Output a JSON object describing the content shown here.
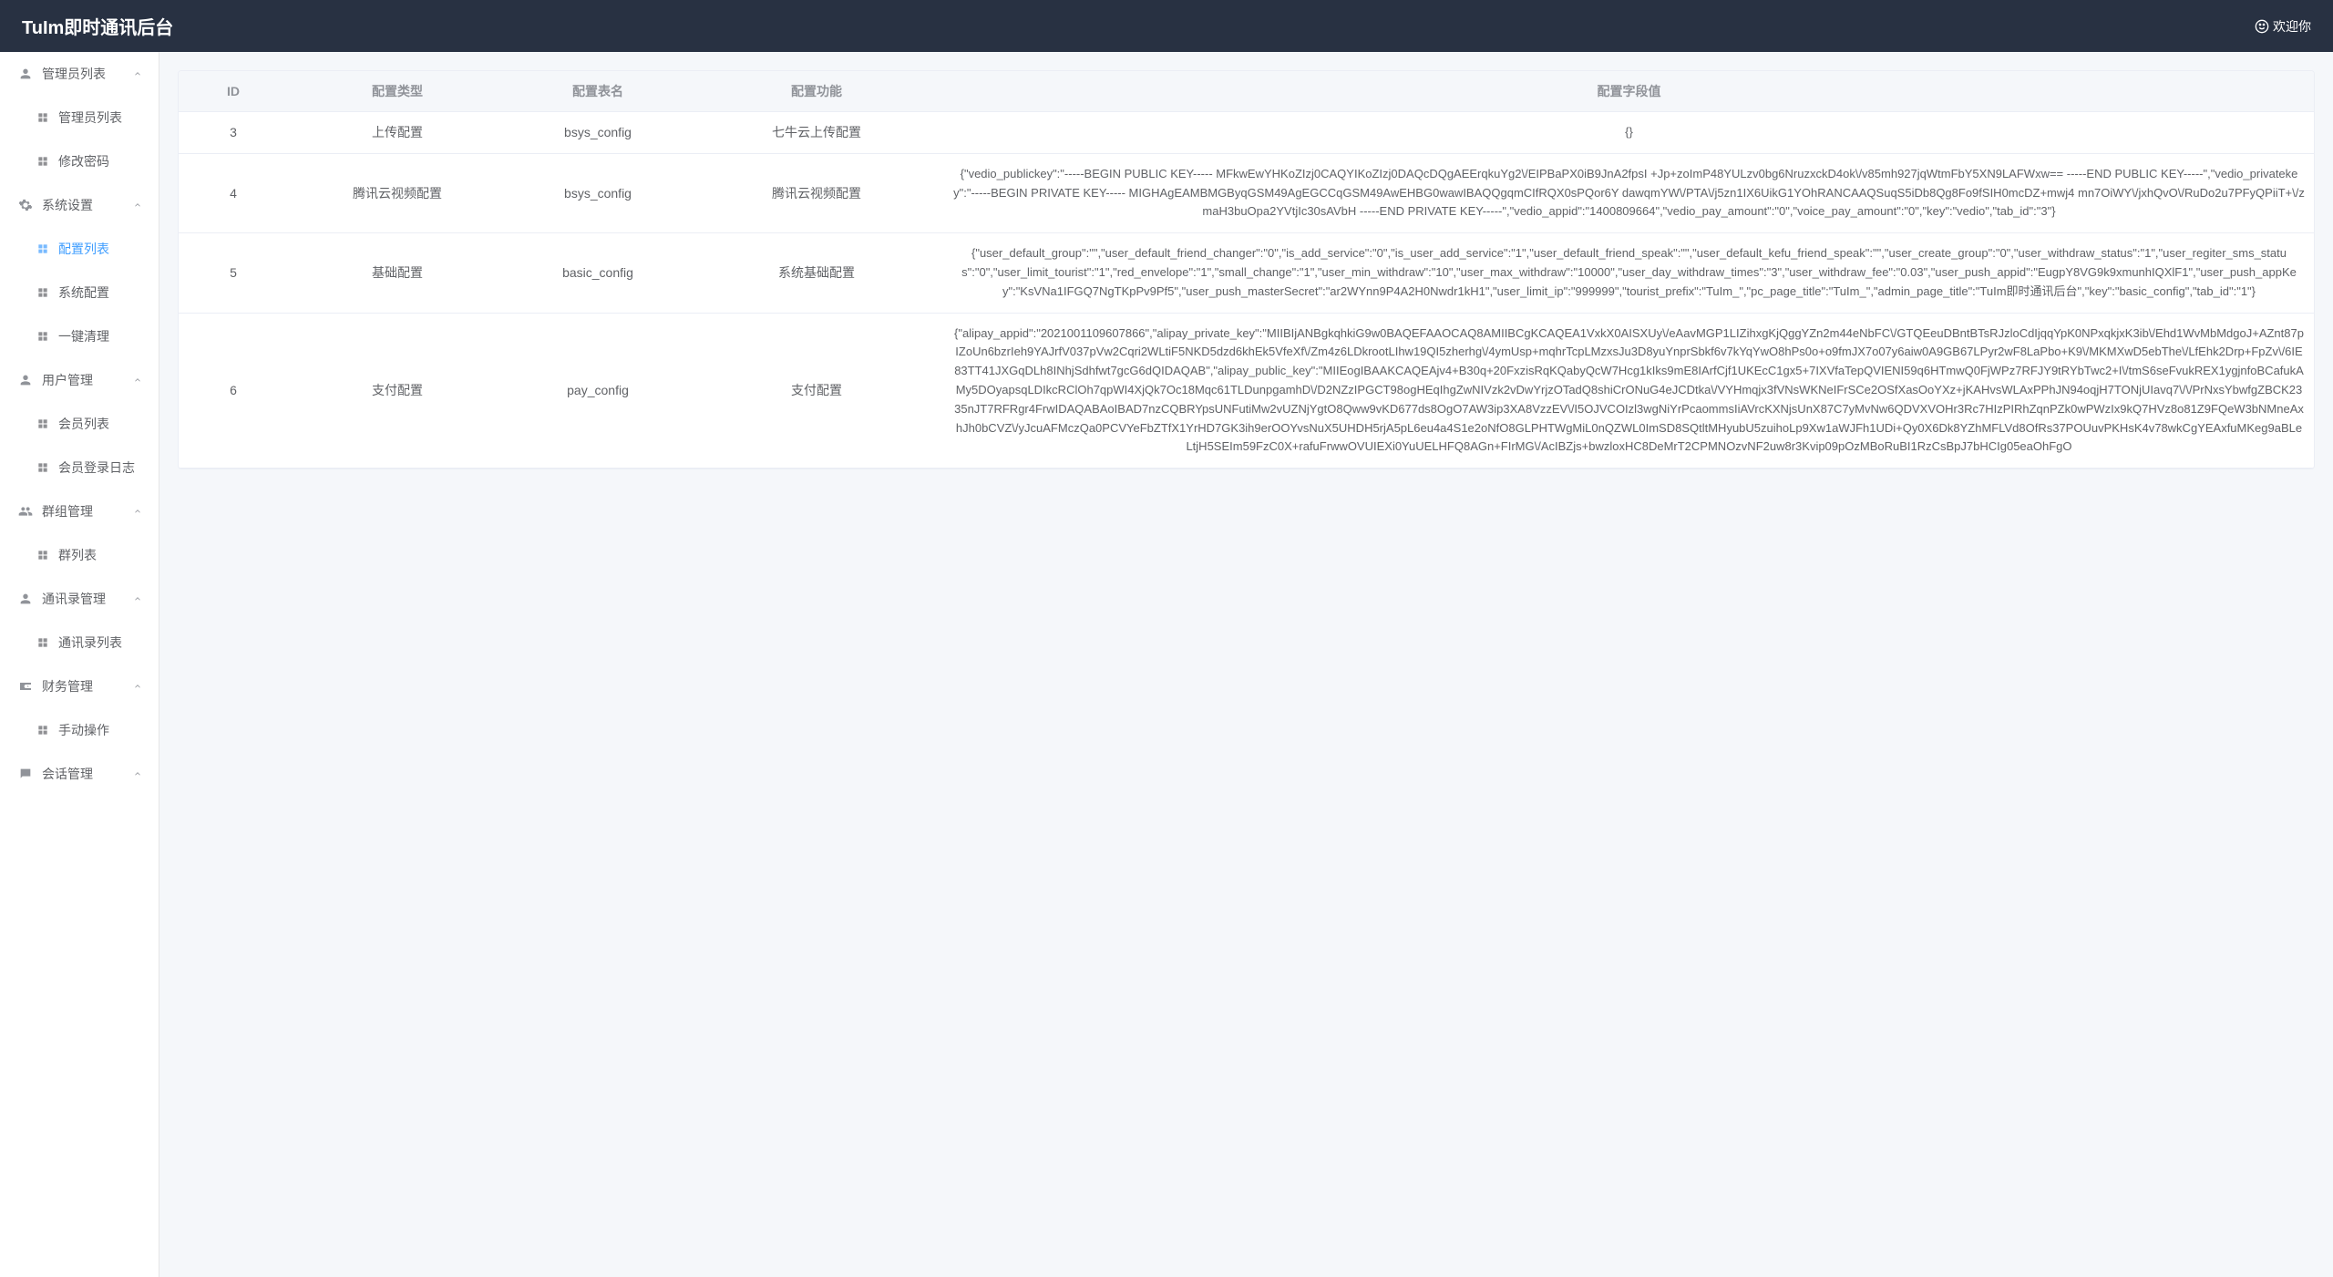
{
  "header": {
    "title": "TuIm即时通讯后台",
    "welcome": "欢迎你"
  },
  "sidebar": {
    "groups": [
      {
        "label": "管理员列表",
        "icon": "user",
        "items": [
          {
            "label": "管理员列表",
            "active": false
          },
          {
            "label": "修改密码",
            "active": false
          }
        ]
      },
      {
        "label": "系统设置",
        "icon": "gear",
        "items": [
          {
            "label": "配置列表",
            "active": true
          },
          {
            "label": "系统配置",
            "active": false
          },
          {
            "label": "一键清理",
            "active": false
          }
        ]
      },
      {
        "label": "用户管理",
        "icon": "user",
        "items": [
          {
            "label": "会员列表",
            "active": false
          },
          {
            "label": "会员登录日志",
            "active": false
          }
        ]
      },
      {
        "label": "群组管理",
        "icon": "group",
        "items": [
          {
            "label": "群列表",
            "active": false
          }
        ]
      },
      {
        "label": "通讯录管理",
        "icon": "user",
        "items": [
          {
            "label": "通讯录列表",
            "active": false
          }
        ]
      },
      {
        "label": "财务管理",
        "icon": "wallet",
        "items": [
          {
            "label": "手动操作",
            "active": false
          }
        ]
      },
      {
        "label": "会话管理",
        "icon": "chat",
        "items": []
      }
    ]
  },
  "table": {
    "columns": [
      "ID",
      "配置类型",
      "配置表名",
      "配置功能",
      "配置字段值"
    ],
    "rows": [
      {
        "id": "3",
        "type": "上传配置",
        "table_name": "bsys_config",
        "func": "七牛云上传配置",
        "value": "{}"
      },
      {
        "id": "4",
        "type": "腾讯云视频配置",
        "table_name": "bsys_config",
        "func": "腾讯云视频配置",
        "value": "{\"vedio_publickey\":\"-----BEGIN PUBLIC KEY----- MFkwEwYHKoZIzj0CAQYIKoZIzj0DAQcDQgAEErqkuYg2\\/EIPBaPX0iB9JnA2fpsI +Jp+zoImP48YULzv0bg6NruzxckD4ok\\/v85mh927jqWtmFbY5XN9LAFWxw== -----END PUBLIC KEY-----\",\"vedio_privatekey\":\"-----BEGIN PRIVATE KEY----- MIGHAgEAMBMGByqGSM49AgEGCCqGSM49AwEHBG0wawIBAQQgqmCIfRQX0sPQor6Y dawqmYW\\/PTA\\/j5zn1IX6UikG1YOhRANCAAQSuqS5iDb8Qg8Fo9fSIH0mcDZ+mwj4 mn7OiWY\\/jxhQvO\\/RuDo2u7PFyQPiiT+\\/zmaH3buOpa2YVtjIc30sAVbH -----END PRIVATE KEY-----\",\"vedio_appid\":\"1400809664\",\"vedio_pay_amount\":\"0\",\"voice_pay_amount\":\"0\",\"key\":\"vedio\",\"tab_id\":\"3\"}"
      },
      {
        "id": "5",
        "type": "基础配置",
        "table_name": "basic_config",
        "func": "系统基础配置",
        "value": "{\"user_default_group\":\"\",\"user_default_friend_changer\":\"0\",\"is_add_service\":\"0\",\"is_user_add_service\":\"1\",\"user_default_friend_speak\":\"\",\"user_default_kefu_friend_speak\":\"\",\"user_create_group\":\"0\",\"user_withdraw_status\":\"1\",\"user_regiter_sms_status\":\"0\",\"user_limit_tourist\":\"1\",\"red_envelope\":\"1\",\"small_change\":\"1\",\"user_min_withdraw\":\"10\",\"user_max_withdraw\":\"10000\",\"user_day_withdraw_times\":\"3\",\"user_withdraw_fee\":\"0.03\",\"user_push_appid\":\"EugpY8VG9k9xmunhIQXlF1\",\"user_push_appKey\":\"KsVNa1IFGQ7NgTKpPv9Pf5\",\"user_push_masterSecret\":\"ar2WYnn9P4A2H0Nwdr1kH1\",\"user_limit_ip\":\"999999\",\"tourist_prefix\":\"TuIm_\",\"pc_page_title\":\"TuIm_\",\"admin_page_title\":\"TuIm即时通讯后台\",\"key\":\"basic_config\",\"tab_id\":\"1\"}"
      },
      {
        "id": "6",
        "type": "支付配置",
        "table_name": "pay_config",
        "func": "支付配置",
        "value": "{\"alipay_appid\":\"2021001109607866\",\"alipay_private_key\":\"MIIBIjANBgkqhkiG9w0BAQEFAAOCAQ8AMIIBCgKCAQEA1VxkX0AISXUy\\/eAavMGP1LIZihxgKjQggYZn2m44eNbFC\\/GTQEeuDBntBTsRJzloCdIjqqYpK0NPxqkjxK3ib\\/Ehd1WvMbMdgoJ+AZnt87pIZoUn6bzrIeh9YAJrfV037pVw2Cqri2WLtiF5NKD5dzd6khEk5VfeXf\\/Zm4z6LDkrootLIhw19QI5zherhg\\/4ymUsp+mqhrTcpLMzxsJu3D8yuYnprSbkf6v7kYqYwO8hPs0o+o9fmJX7o07y6aiw0A9GB67LPyr2wF8LaPbo+K9\\/MKMXwD5ebThe\\/LfEhk2Drp+FpZv\\/6IE83TT41JXGqDLh8INhjSdhfwt7gcG6dQIDAQAB\",\"alipay_public_key\":\"MIIEogIBAAKCAQEAjv4+B30q+20FxzisRqKQabyQcW7Hcg1kIks9mE8IArfCjf1UKEcC1gx5+7IXVfaTepQVIENI59q6HTmwQ0FjWPz7RFJY9tRYbTwc2+I\\/tmS6seFvukREX1ygjnfoBCafukAMy5DOyapsqLDIkcRClOh7qpWI4XjQk7Oc18Mqc61TLDunpgamhD\\/D2NZzIPGCT98ogHEqIhgZwNIVzk2vDwYrjzOTadQ8shiCrONuG4eJCDtka\\/VYHmqjx3fVNsWKNeIFrSCe2OSfXasOoYXz+jKAHvsWLAxPPhJN94oqjH7TONjUIavq7\\/\\/PrNxsYbwfgZBCK2335nJT7RFRgr4FrwIDAQABAoIBAD7nzCQBRYpsUNFutiMw2vUZNjYgtO8Qww9vKD677ds8OgO7AW3ip3XA8VzzEV\\/I5OJVCOIzl3wgNiYrPcaommsIiAVrcKXNjsUnX87C7yMvNw6QDVXVOHr3Rc7HIzPIRhZqnPZk0wPWzIx9kQ7HVz8o81Z9FQeW3bNMneAxhJh0bCVZ\\/yJcuAFMczQa0PCVYeFbZTfX1YrHD7GK3ih9erOOYvsNuX5UHDH5rjA5pL6eu4a4S1e2oNfO8GLPHTWgMiL0nQZWL0ImSD8SQtltMHyubU5zuihoLp9Xw1aWJFh1UDi+Qy0X6Dk8YZhMFLVd8OfRs37POUuvPKHsK4v78wkCgYEAxfuMKeg9aBLeLtjH5SEIm59FzC0X+rafuFrwwOVUIEXi0YuUELHFQ8AGn+FIrMG\\/AcIBZjs+bwzloxHC8DeMrT2CPMNOzvNF2uw8r3Kvip09pOzMBoRuBI1RzCsBpJ7bHCIg05eaOhFgO"
      }
    ]
  }
}
